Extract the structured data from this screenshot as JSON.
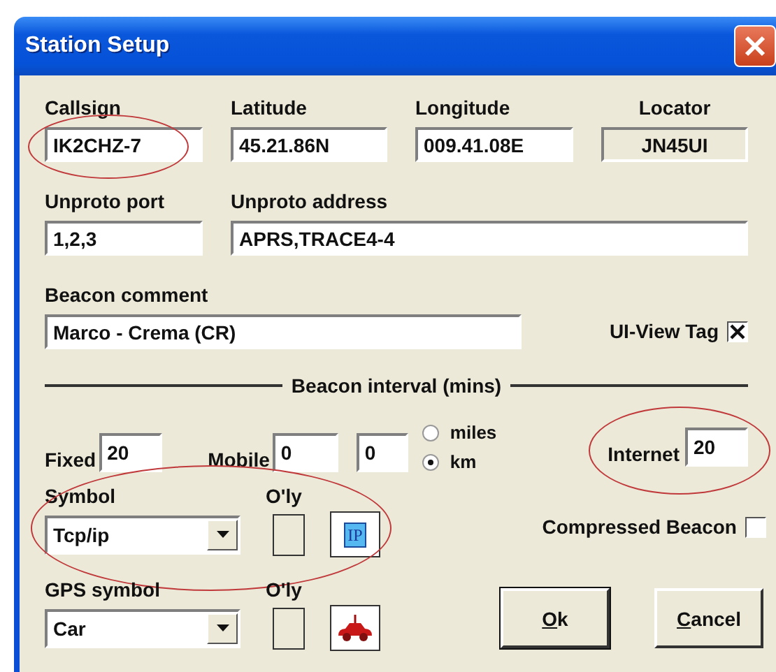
{
  "window": {
    "title": "Station Setup"
  },
  "station_fields": [
    {
      "label": "Callsign",
      "value": "IK2CHZ-7",
      "readonly": false,
      "highlighted": true
    },
    {
      "label": "Latitude",
      "value": "45.21.86N",
      "readonly": false,
      "highlighted": false
    },
    {
      "label": "Longitude",
      "value": "009.41.08E",
      "readonly": false,
      "highlighted": false
    },
    {
      "label": "Locator",
      "value": "JN45UI",
      "readonly": true,
      "highlighted": false
    }
  ],
  "unproto_fields": [
    {
      "label": "Unproto port",
      "value": "1,2,3"
    },
    {
      "label": "Unproto address",
      "value": "APRS,TRACE4-4"
    }
  ],
  "beacon_comment": {
    "label": "Beacon comment",
    "value": "Marco - Crema (CR)"
  },
  "ui_view_tag": {
    "label": "UI-View Tag",
    "checked": true
  },
  "beacon_interval": {
    "title": "Beacon interval (mins)",
    "fixed": {
      "label": "Fixed",
      "value": "20"
    },
    "mobile": {
      "label": "Mobile",
      "values": [
        "0",
        "0"
      ]
    },
    "units": [
      {
        "label": "miles",
        "selected": false
      },
      {
        "label": "km",
        "selected": true
      }
    ],
    "internet": {
      "label": "Internet",
      "value": "20",
      "highlighted": true
    }
  },
  "symbol": {
    "label": "Symbol",
    "overlay_label": "O'ly",
    "value": "Tcp/ip",
    "icon_text": "IP",
    "highlighted": true
  },
  "gps_symbol": {
    "label": "GPS symbol",
    "overlay_label": "O'ly",
    "value": "Car",
    "highlighted": false
  },
  "compressed_beacon": {
    "label": "Compressed Beacon",
    "checked": false
  },
  "buttons": [
    {
      "label": "Ok"
    },
    {
      "label": "Cancel"
    }
  ]
}
